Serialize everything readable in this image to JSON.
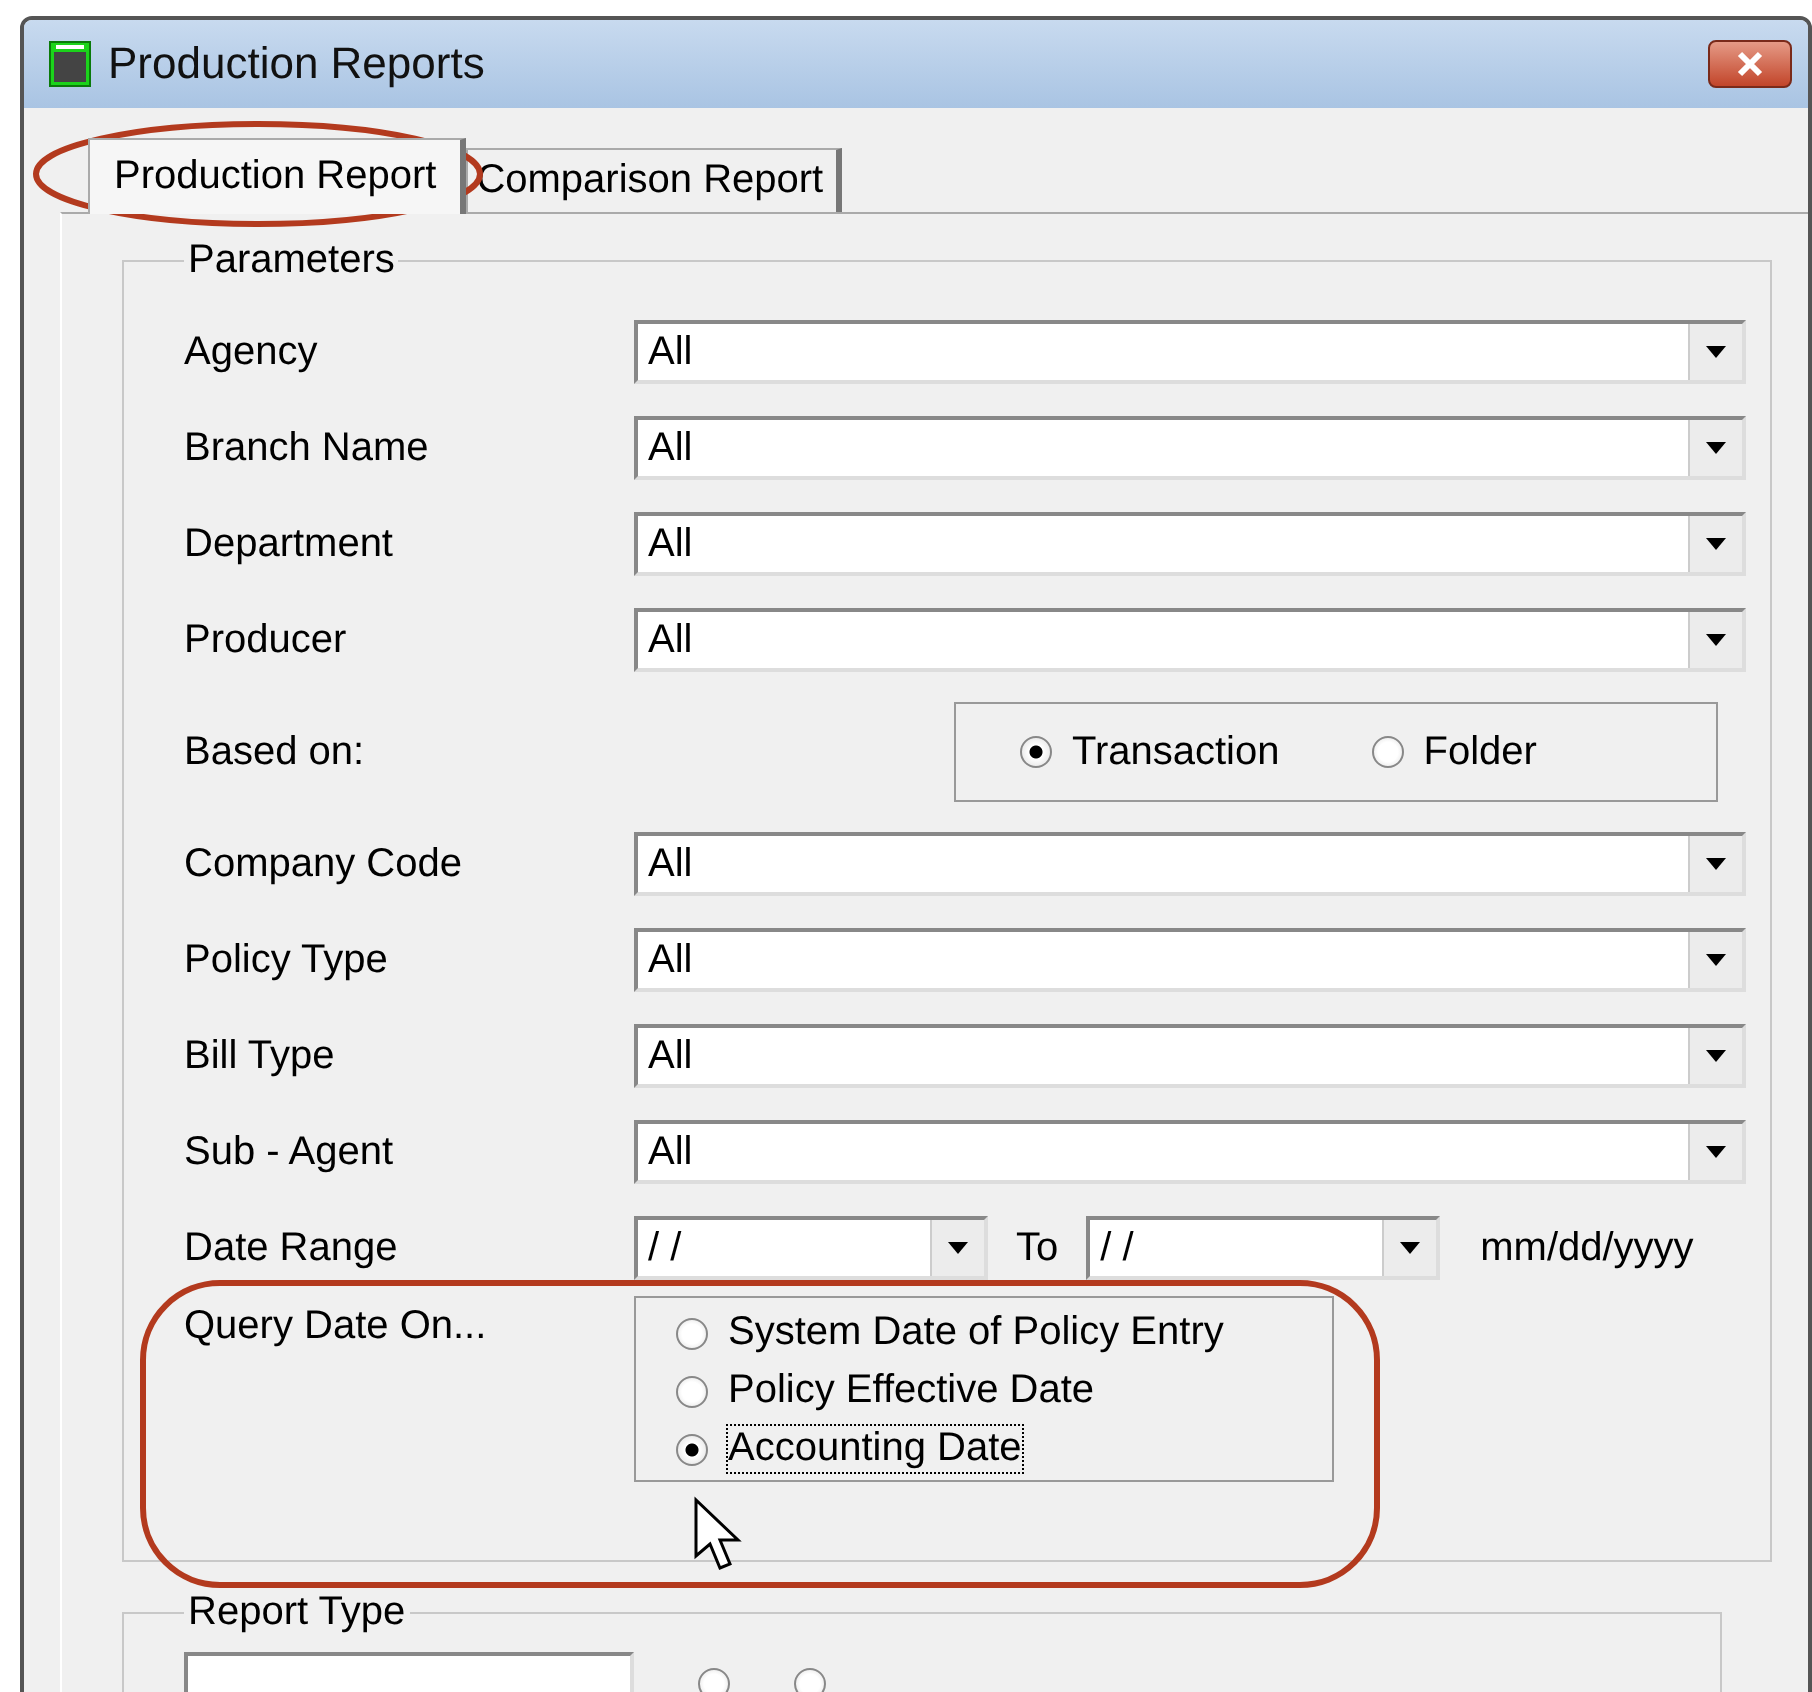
{
  "window": {
    "title": "Production Reports"
  },
  "tabs": [
    {
      "label": "Production Report",
      "selected": true
    },
    {
      "label": "Comparison Report",
      "selected": false
    }
  ],
  "parameters": {
    "title": "Parameters",
    "fields": [
      {
        "kind": "combo",
        "label": "Agency",
        "value": "All"
      },
      {
        "kind": "combo",
        "label": "Branch Name",
        "value": "All"
      },
      {
        "kind": "combo",
        "label": "Department",
        "value": "All"
      },
      {
        "kind": "combo",
        "label": "Producer",
        "value": "All"
      },
      {
        "kind": "radio_group",
        "label": "Based on:",
        "options": [
          {
            "label": "Transaction",
            "selected": true
          },
          {
            "label": "Folder",
            "selected": false
          }
        ]
      },
      {
        "kind": "combo",
        "label": "Company Code",
        "value": "All"
      },
      {
        "kind": "combo",
        "label": "Policy Type",
        "value": "All"
      },
      {
        "kind": "combo",
        "label": "Bill Type",
        "value": "All"
      },
      {
        "kind": "combo",
        "label": "Sub - Agent",
        "value": "All"
      },
      {
        "kind": "date_range",
        "label": "Date Range",
        "from": "/ /",
        "to_label": "To",
        "to": "/ /",
        "format": "mm/dd/yyyy"
      },
      {
        "kind": "radio_list",
        "label": "Query Date On...",
        "options": [
          {
            "label": "System Date of Policy Entry",
            "selected": false,
            "focused": false
          },
          {
            "label": "Policy Effective Date",
            "selected": false,
            "focused": false
          },
          {
            "label": "Accounting Date",
            "selected": true,
            "focused": true
          }
        ]
      }
    ]
  },
  "report_type": {
    "title": "Report Type",
    "options": [
      {
        "selected": false
      },
      {
        "selected": false
      }
    ]
  }
}
